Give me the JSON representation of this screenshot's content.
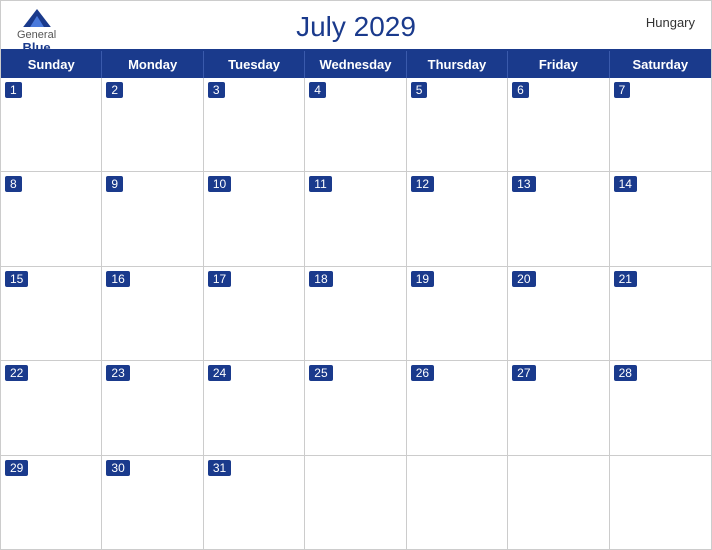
{
  "header": {
    "title": "July 2029",
    "country": "Hungary",
    "logo": {
      "general": "General",
      "blue": "Blue"
    }
  },
  "days": {
    "headers": [
      "Sunday",
      "Monday",
      "Tuesday",
      "Wednesday",
      "Thursday",
      "Friday",
      "Saturday"
    ]
  },
  "weeks": [
    [
      {
        "date": "1",
        "active": true
      },
      {
        "date": "2",
        "active": true
      },
      {
        "date": "3",
        "active": true
      },
      {
        "date": "4",
        "active": true
      },
      {
        "date": "5",
        "active": true
      },
      {
        "date": "6",
        "active": true
      },
      {
        "date": "7",
        "active": true
      }
    ],
    [
      {
        "date": "8",
        "active": true
      },
      {
        "date": "9",
        "active": true
      },
      {
        "date": "10",
        "active": true
      },
      {
        "date": "11",
        "active": true
      },
      {
        "date": "12",
        "active": true
      },
      {
        "date": "13",
        "active": true
      },
      {
        "date": "14",
        "active": true
      }
    ],
    [
      {
        "date": "15",
        "active": true
      },
      {
        "date": "16",
        "active": true
      },
      {
        "date": "17",
        "active": true
      },
      {
        "date": "18",
        "active": true
      },
      {
        "date": "19",
        "active": true
      },
      {
        "date": "20",
        "active": true
      },
      {
        "date": "21",
        "active": true
      }
    ],
    [
      {
        "date": "22",
        "active": true
      },
      {
        "date": "23",
        "active": true
      },
      {
        "date": "24",
        "active": true
      },
      {
        "date": "25",
        "active": true
      },
      {
        "date": "26",
        "active": true
      },
      {
        "date": "27",
        "active": true
      },
      {
        "date": "28",
        "active": true
      }
    ],
    [
      {
        "date": "29",
        "active": true
      },
      {
        "date": "30",
        "active": true
      },
      {
        "date": "31",
        "active": true
      },
      {
        "date": "",
        "active": false
      },
      {
        "date": "",
        "active": false
      },
      {
        "date": "",
        "active": false
      },
      {
        "date": "",
        "active": false
      }
    ]
  ]
}
